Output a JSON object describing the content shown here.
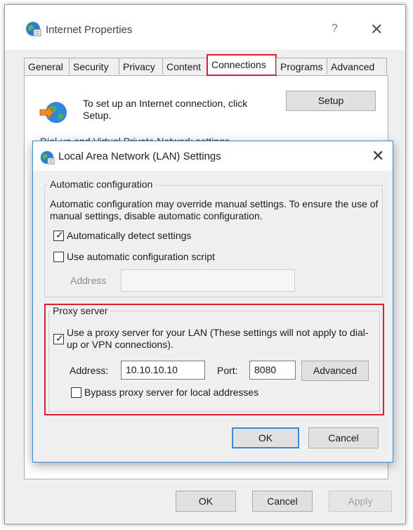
{
  "window": {
    "title": "Internet Properties",
    "help": "?",
    "close": "✕"
  },
  "tabs": [
    {
      "label": "General"
    },
    {
      "label": "Security"
    },
    {
      "label": "Privacy"
    },
    {
      "label": "Content"
    },
    {
      "label": "Connections"
    },
    {
      "label": "Programs"
    },
    {
      "label": "Advanced"
    }
  ],
  "active_tab": "Connections",
  "connections": {
    "intro_text": "To set up an Internet connection, click Setup.",
    "setup_label": "Setup",
    "dialup_heading": "Dial-up and Virtual Private Network settings"
  },
  "lan_dialog": {
    "title": "Local Area Network (LAN) Settings",
    "close": "✕",
    "auto_config": {
      "legend": "Automatic configuration",
      "description": "Automatic configuration may override manual settings.  To ensure the use of manual settings, disable automatic configuration.",
      "auto_detect_label": "Automatically detect settings",
      "auto_detect_checked": true,
      "script_label": "Use automatic configuration script",
      "script_checked": false,
      "address_label": "Address",
      "address_value": ""
    },
    "proxy": {
      "legend": "Proxy server",
      "use_proxy_label": "Use a proxy server for your LAN (These settings will not apply to dial-up or VPN connections).",
      "use_proxy_checked": true,
      "address_label": "Address:",
      "address_value": "10.10.10.10",
      "port_label": "Port:",
      "port_value": "8080",
      "advanced_label": "Advanced",
      "bypass_label": "Bypass proxy server for local addresses",
      "bypass_checked": false
    },
    "ok_label": "OK",
    "cancel_label": "Cancel"
  },
  "footer": {
    "ok_label": "OK",
    "cancel_label": "Cancel",
    "apply_label": "Apply"
  },
  "colors": {
    "highlight_red": "#d8212a",
    "focus_blue": "#3c8ad8"
  }
}
